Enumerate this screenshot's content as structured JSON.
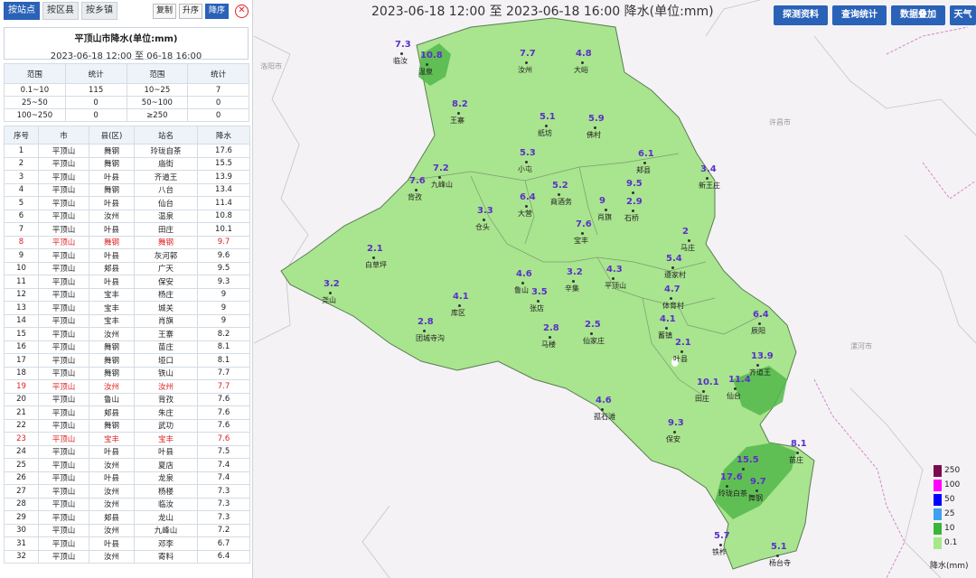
{
  "tabs": [
    {
      "label": "按站点",
      "active": true
    },
    {
      "label": "按区县",
      "active": false
    },
    {
      "label": "按乡镇",
      "active": false
    }
  ],
  "toolbar": {
    "copy": "复制",
    "asc": "升序",
    "desc": "降序"
  },
  "panel": {
    "title": "平顶山市降水(单位:mm)",
    "range_start": "2023-06-18 12:00",
    "range_sep": "至",
    "range_end": "06-18 16:00"
  },
  "stats": {
    "headers": [
      "范围",
      "统计",
      "范围",
      "统计"
    ],
    "rows": [
      [
        "0.1~10",
        "115",
        "10~25",
        "7"
      ],
      [
        "25~50",
        "0",
        "50~100",
        "0"
      ],
      [
        "100~250",
        "0",
        "≥250",
        "0"
      ]
    ]
  },
  "list": {
    "headers": [
      "序号",
      "市",
      "县(区)",
      "站名",
      "降水"
    ],
    "rows": [
      [
        "1",
        "平顶山",
        "舞钢",
        "玲珑自茶",
        "17.6"
      ],
      [
        "2",
        "平顶山",
        "舞钢",
        "庙街",
        "15.5"
      ],
      [
        "3",
        "平顶山",
        "叶县",
        "齐道王",
        "13.9"
      ],
      [
        "4",
        "平顶山",
        "舞钢",
        "八台",
        "13.4"
      ],
      [
        "5",
        "平顶山",
        "叶县",
        "仙台",
        "11.4"
      ],
      [
        "6",
        "平顶山",
        "汝州",
        "温泉",
        "10.8"
      ],
      [
        "7",
        "平顶山",
        "叶县",
        "田庄",
        "10.1"
      ],
      [
        "8",
        "平顶山",
        "舞钢",
        "舞钢",
        "9.7"
      ],
      [
        "9",
        "平顶山",
        "叶县",
        "灰河郭",
        "9.6"
      ],
      [
        "10",
        "平顶山",
        "郏县",
        "广天",
        "9.5"
      ],
      [
        "11",
        "平顶山",
        "叶县",
        "保安",
        "9.3"
      ],
      [
        "12",
        "平顶山",
        "宝丰",
        "杨庄",
        "9"
      ],
      [
        "13",
        "平顶山",
        "宝丰",
        "城关",
        "9"
      ],
      [
        "14",
        "平顶山",
        "宝丰",
        "肖旗",
        "9"
      ],
      [
        "15",
        "平顶山",
        "汝州",
        "王寨",
        "8.2"
      ],
      [
        "16",
        "平顶山",
        "舞钢",
        "苗庄",
        "8.1"
      ],
      [
        "17",
        "平顶山",
        "舞钢",
        "垭口",
        "8.1"
      ],
      [
        "18",
        "平顶山",
        "舞钢",
        "铁山",
        "7.7"
      ],
      [
        "19",
        "平顶山",
        "汝州",
        "汝州",
        "7.7"
      ],
      [
        "20",
        "平顶山",
        "鲁山",
        "背孜",
        "7.6"
      ],
      [
        "21",
        "平顶山",
        "郏县",
        "朱庄",
        "7.6"
      ],
      [
        "22",
        "平顶山",
        "舞钢",
        "武功",
        "7.6"
      ],
      [
        "23",
        "平顶山",
        "宝丰",
        "宝丰",
        "7.6"
      ],
      [
        "24",
        "平顶山",
        "叶县",
        "叶县",
        "7.5"
      ],
      [
        "25",
        "平顶山",
        "汝州",
        "夏店",
        "7.4"
      ],
      [
        "26",
        "平顶山",
        "叶县",
        "龙泉",
        "7.4"
      ],
      [
        "27",
        "平顶山",
        "汝州",
        "杨楼",
        "7.3"
      ],
      [
        "28",
        "平顶山",
        "汝州",
        "临汝",
        "7.3"
      ],
      [
        "29",
        "平顶山",
        "郏县",
        "龙山",
        "7.3"
      ],
      [
        "30",
        "平顶山",
        "汝州",
        "九峰山",
        "7.2"
      ],
      [
        "31",
        "平顶山",
        "叶县",
        "邓李",
        "6.7"
      ],
      [
        "32",
        "平顶山",
        "汝州",
        "寄料",
        "6.4"
      ]
    ],
    "red_rows": [
      8,
      19,
      23
    ]
  },
  "map": {
    "title": "2023-06-18 12:00 至 2023-06-18 16:00 降水(单位:mm)",
    "buttons": [
      "探测资料",
      "查询统计",
      "数据叠加",
      "天气"
    ],
    "cities": [
      "洛阳市",
      "许昌市",
      "漯河市"
    ],
    "stations": [
      {
        "v": "7.3",
        "n": "临汝"
      },
      {
        "v": "10.8",
        "n": "温泉"
      },
      {
        "v": "7.7",
        "n": "汝州"
      },
      {
        "v": "4.8",
        "n": "大峪"
      },
      {
        "v": "8.2",
        "n": "王寨"
      },
      {
        "v": "5.1",
        "n": "纸坊"
      },
      {
        "v": "5.9",
        "n": "佛村"
      },
      {
        "v": "6.1",
        "n": "郏县"
      },
      {
        "v": "5.3",
        "n": "小屯"
      },
      {
        "v": "3.4",
        "n": "新王庄"
      },
      {
        "v": "7.6",
        "n": "背孜"
      },
      {
        "v": "7.2",
        "n": "九峰山"
      },
      {
        "v": "6.4",
        "n": "大营"
      },
      {
        "v": "5.2",
        "n": "商酒务"
      },
      {
        "v": "9",
        "n": "肖旗"
      },
      {
        "v": "9.5",
        "n": ""
      },
      {
        "v": "2.9",
        "n": "石桥"
      },
      {
        "v": "3.3",
        "n": "仓头"
      },
      {
        "v": "7.6",
        "n": "宝丰"
      },
      {
        "v": "2",
        "n": "马庄"
      },
      {
        "v": "2.1",
        "n": "白草坪"
      },
      {
        "v": "5.4",
        "n": "遵家村"
      },
      {
        "v": "4.6",
        "n": "鲁山"
      },
      {
        "v": "3.2",
        "n": "辛集"
      },
      {
        "v": "4.3",
        "n": "平顶山"
      },
      {
        "v": "3.2",
        "n": "尧山"
      },
      {
        "v": "3.5",
        "n": "张店"
      },
      {
        "v": "4.7",
        "n": "体育村"
      },
      {
        "v": "4.1",
        "n": "库区"
      },
      {
        "v": "6.4",
        "n": "辰阳"
      },
      {
        "v": "2.8",
        "n": "团城寺沟"
      },
      {
        "v": "2.8",
        "n": "马楼"
      },
      {
        "v": "2.5",
        "n": "仙家庄"
      },
      {
        "v": "4.1",
        "n": "蓄镇"
      },
      {
        "v": "2.1",
        "n": "叶县"
      },
      {
        "v": "13.9",
        "n": "齐道王"
      },
      {
        "v": "10.1",
        "n": "田庄"
      },
      {
        "v": "11.4",
        "n": "仙台"
      },
      {
        "v": "4.6",
        "n": "孤石滩"
      },
      {
        "v": "9.3",
        "n": "保安"
      },
      {
        "v": "8.1",
        "n": "苗庄"
      },
      {
        "v": "15.5",
        "n": ""
      },
      {
        "v": "17.6",
        "n": "玲珑白茶"
      },
      {
        "v": "9.7",
        "n": "舞钢"
      },
      {
        "v": "5.7",
        "n": "铁柞"
      },
      {
        "v": "5.1",
        "n": "杨台寺"
      }
    ]
  },
  "legend": {
    "labels": [
      "250",
      "100",
      "50",
      "25",
      "10",
      "0.1"
    ],
    "colors": [
      "#7b0a4e",
      "#ff00ff",
      "#0000ff",
      "#3ea0f0",
      "#3ab53a",
      "#a6e88a"
    ],
    "unit": "降水(mm)"
  }
}
